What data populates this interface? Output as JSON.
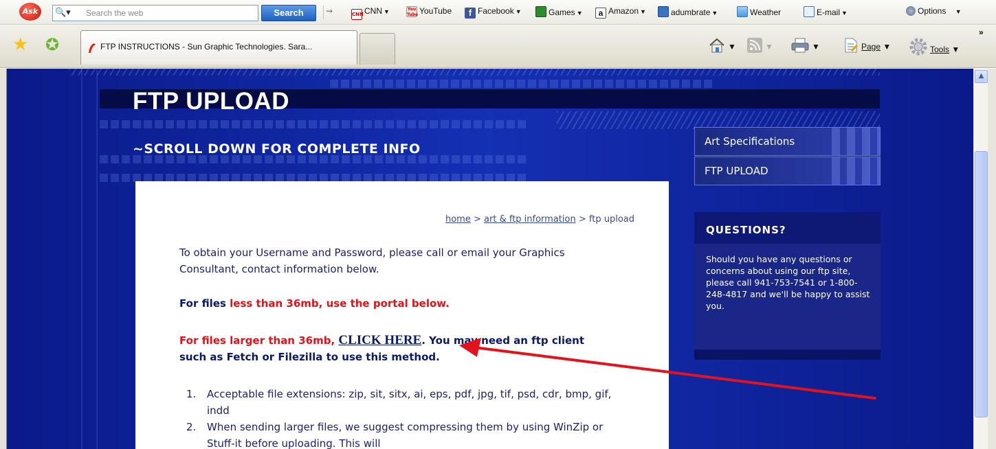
{
  "ask_toolbar": {
    "search_placeholder": "Search the web",
    "search_button": "Search",
    "links": [
      {
        "label": "CNN",
        "icon": "cnn-icon"
      },
      {
        "label": "YouTube",
        "icon": "youtube-icon"
      },
      {
        "label": "Facebook",
        "icon": "facebook-icon"
      },
      {
        "label": "Games",
        "icon": "games-icon"
      },
      {
        "label": "Amazon",
        "icon": "amazon-icon"
      },
      {
        "label": "adumbrate",
        "icon": "adumbrate-icon"
      },
      {
        "label": "Weather",
        "icon": "weather-icon"
      },
      {
        "label": "E-mail",
        "icon": "email-icon"
      }
    ],
    "options_label": "Options"
  },
  "tabs": {
    "active_title": "FTP INSTRUCTIONS - Sun Graphic Technologies. Sara..."
  },
  "command_bar": {
    "page_label": "Page",
    "tools_label": "Tools"
  },
  "page": {
    "title": "FTP UPLOAD",
    "subtitle": "~SCROLL DOWN FOR COMPLETE INFO",
    "nav": [
      "Art Specifications",
      "FTP UPLOAD"
    ],
    "questions": {
      "heading": "QUESTIONS?",
      "body": "Should you have any questions or concerns about using our ftp site, please call 941-753-7541 or 1-800-248-4817 and we'll be happy to assist you."
    },
    "breadcrumb": {
      "home": "home",
      "sep1": ">",
      "section": "art & ftp information",
      "sep2": ">",
      "current": "ftp upload"
    },
    "intro": "To obtain your Username and Password, please call or email your Graphics Consultant, contact information below.",
    "small_files": {
      "lead": "For files ",
      "highlight": "less than 36mb, use the portal below."
    },
    "large_files": {
      "lead": "For files larger than 36mb, ",
      "link": "CLICK HERE",
      "rest": ". You may need an ftp client such as Fetch or Filezilla to use this method."
    },
    "steps": [
      {
        "num": "1.",
        "text": "Acceptable file extensions: zip, sit, sitx, ai, eps, pdf, jpg, tif, psd, cdr, bmp, gif, indd"
      },
      {
        "num": "2.",
        "text": "When sending larger files, we suggest compressing them by using WinZip or Stuff-it before uploading. This will"
      }
    ]
  },
  "colors": {
    "page_bg": "#1430b3",
    "annotation_arrow": "#e3131b",
    "accent_red": "#e0131b",
    "text_navy": "#0b1a66"
  }
}
